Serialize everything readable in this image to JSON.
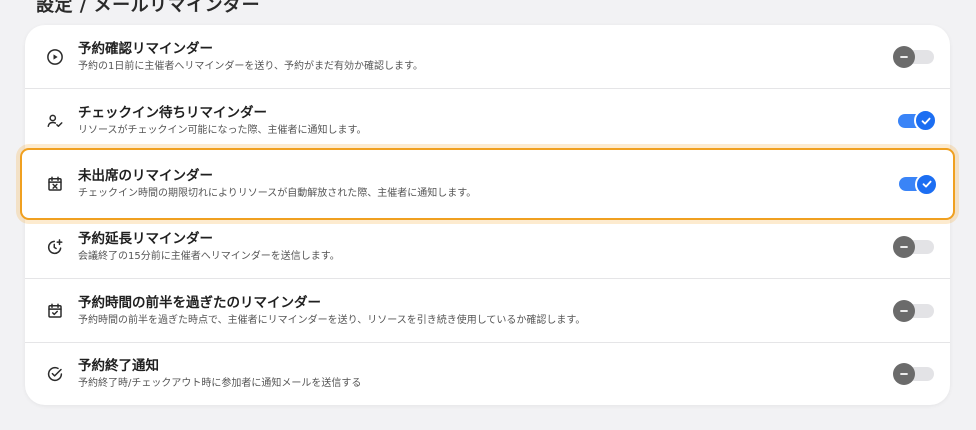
{
  "header": {
    "title": "設定 / メールリマインダー"
  },
  "reminders": [
    {
      "title": "予約確認リマインダー",
      "description": "予約の1日前に主催者へリマインダーを送り、予約がまだ有効か確認します。",
      "icon": "play-circle-icon",
      "enabled": false,
      "highlighted": false
    },
    {
      "title": "チェックイン待ちリマインダー",
      "description": "リソースがチェックイン可能になった際、主催者に通知します。",
      "icon": "user-check-icon",
      "enabled": true,
      "highlighted": false
    },
    {
      "title": "未出席のリマインダー",
      "description": "チェックイン時間の期限切れによりリソースが自動解放された際、主催者に通知します。",
      "icon": "calendar-x-icon",
      "enabled": true,
      "highlighted": true
    },
    {
      "title": "予約延長リマインダー",
      "description": "会議終了の15分前に主催者へリマインダーを送信します。",
      "icon": "clock-plus-icon",
      "enabled": false,
      "highlighted": false
    },
    {
      "title": "予約時間の前半を過ぎたのリマインダー",
      "description": "予約時間の前半を過ぎた時点で、主催者にリマインダーを送り、リソースを引き続き使用しているか確認します。",
      "icon": "calendar-check-icon",
      "enabled": false,
      "highlighted": false
    },
    {
      "title": "予約終了通知",
      "description": "予約終了時/チェックアウト時に参加者に通知メールを送信する",
      "icon": "check-circle-icon",
      "enabled": false,
      "highlighted": false
    }
  ],
  "colors": {
    "toggle_on": "#3a84f7",
    "toggle_off_knob": "#6b6b6b",
    "highlight_border": "#f0a020"
  }
}
